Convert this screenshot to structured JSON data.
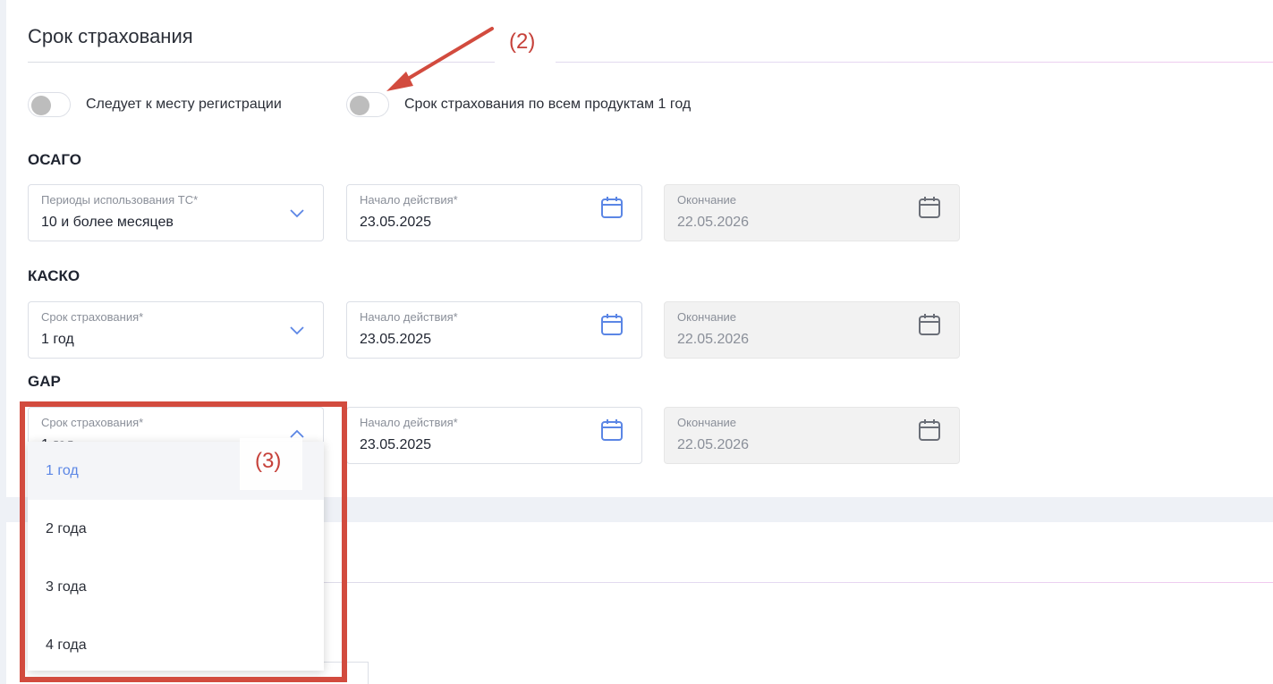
{
  "section": {
    "title": "Срок страхования"
  },
  "toggles": [
    {
      "label": "Следует к месту регистрации",
      "on": false
    },
    {
      "label": "Срок страхования по всем продуктам 1 год",
      "on": false
    }
  ],
  "groups": [
    {
      "name": "ОСАГО",
      "select": {
        "label": "Периоды использования ТС*",
        "value": "10 и более месяцев"
      },
      "start": {
        "label": "Начало действия*",
        "value": "23.05.2025"
      },
      "end": {
        "label": "Окончание",
        "value": "22.05.2026"
      }
    },
    {
      "name": "КАСКО",
      "select": {
        "label": "Срок страхования*",
        "value": "1 год"
      },
      "start": {
        "label": "Начало действия*",
        "value": "23.05.2025"
      },
      "end": {
        "label": "Окончание",
        "value": "22.05.2026"
      }
    },
    {
      "name": "GAP",
      "select": {
        "label": "Срок страхования*",
        "value": "1 год"
      },
      "start": {
        "label": "Начало действия*",
        "value": "23.05.2025"
      },
      "end": {
        "label": "Окончание",
        "value": "22.05.2026"
      }
    }
  ],
  "dropdown": {
    "options": [
      "1 год",
      "2 года",
      "3 года",
      "4 года"
    ],
    "selected": "1 год"
  },
  "annotations": {
    "two": "(2)",
    "three": "(3)"
  },
  "colors": {
    "accent": "#5b86e5",
    "annotation": "#d24b3e",
    "icon": "#5b86e5"
  }
}
